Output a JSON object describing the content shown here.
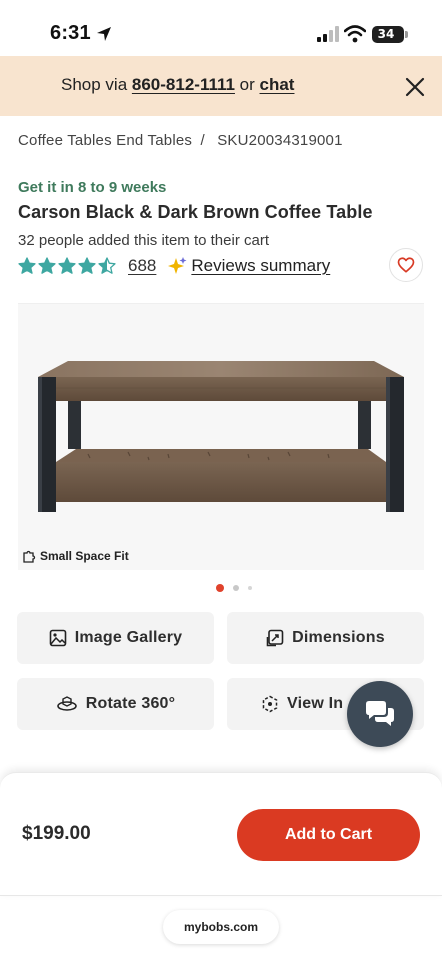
{
  "status_bar": {
    "time": "6:31",
    "battery": "34"
  },
  "banner": {
    "prefix": "Shop via ",
    "phone": "860-812-1111",
    "middle": " or ",
    "chat": "chat"
  },
  "breadcrumb": {
    "category": "Coffee Tables End Tables",
    "separator": "/",
    "sku": "SKU20034319001"
  },
  "product": {
    "delivery": "Get it in 8 to 9 weeks",
    "title": "Carson Black & Dark Brown Coffee Table",
    "cart_count": "32 people added this item to their cart",
    "rating": 4.5,
    "review_count": "688",
    "reviews_summary": "Reviews summary",
    "badge": "Small Space Fit"
  },
  "carousel": {
    "total": 3,
    "active": 1
  },
  "media_buttons": {
    "gallery": "Image Gallery",
    "dimensions": "Dimensions",
    "rotate": "Rotate 360°",
    "view_in": "View In"
  },
  "purchase": {
    "price": "$199.00",
    "add_to_cart": "Add to Cart"
  },
  "browser": {
    "url": "mybobs.com"
  },
  "colors": {
    "accent": "#da3a22",
    "banner": "#f8e4cf",
    "delivery": "#3f7a5c",
    "stars": "#3ea7a1",
    "chat_fab": "#3d4a57"
  }
}
